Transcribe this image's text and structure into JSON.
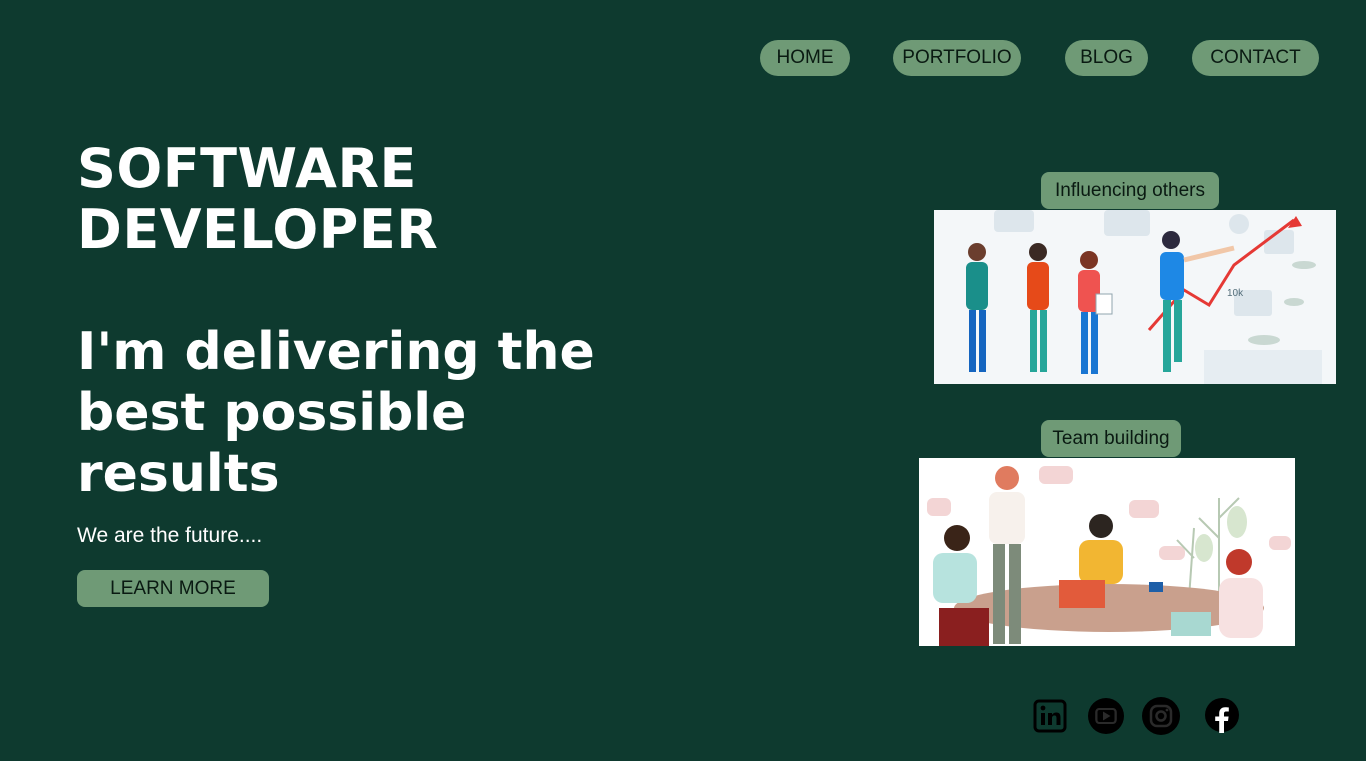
{
  "nav": {
    "home": "HOME",
    "portfolio": "PORTFOLIO",
    "blog": "BLOG",
    "contact": "CONTACT"
  },
  "hero": {
    "title": "SOFTWARE DEVELOPER",
    "subtitle": "I'm delivering the best possible results",
    "tagline": "We are the future....",
    "cta": "LEARN MORE"
  },
  "cards": [
    {
      "label": "Influencing others",
      "image": "team-presentation-illustration"
    },
    {
      "label": "Team building",
      "image": "team-meeting-illustration"
    }
  ],
  "social": [
    {
      "icon": "linkedin-icon"
    },
    {
      "icon": "youtube-icon"
    },
    {
      "icon": "instagram-icon"
    },
    {
      "icon": "facebook-icon"
    }
  ],
  "colors": {
    "background": "#0e3a2f",
    "button": "#6f9a76",
    "text_light": "#ffffff",
    "text_dark": "#0a1a12"
  }
}
